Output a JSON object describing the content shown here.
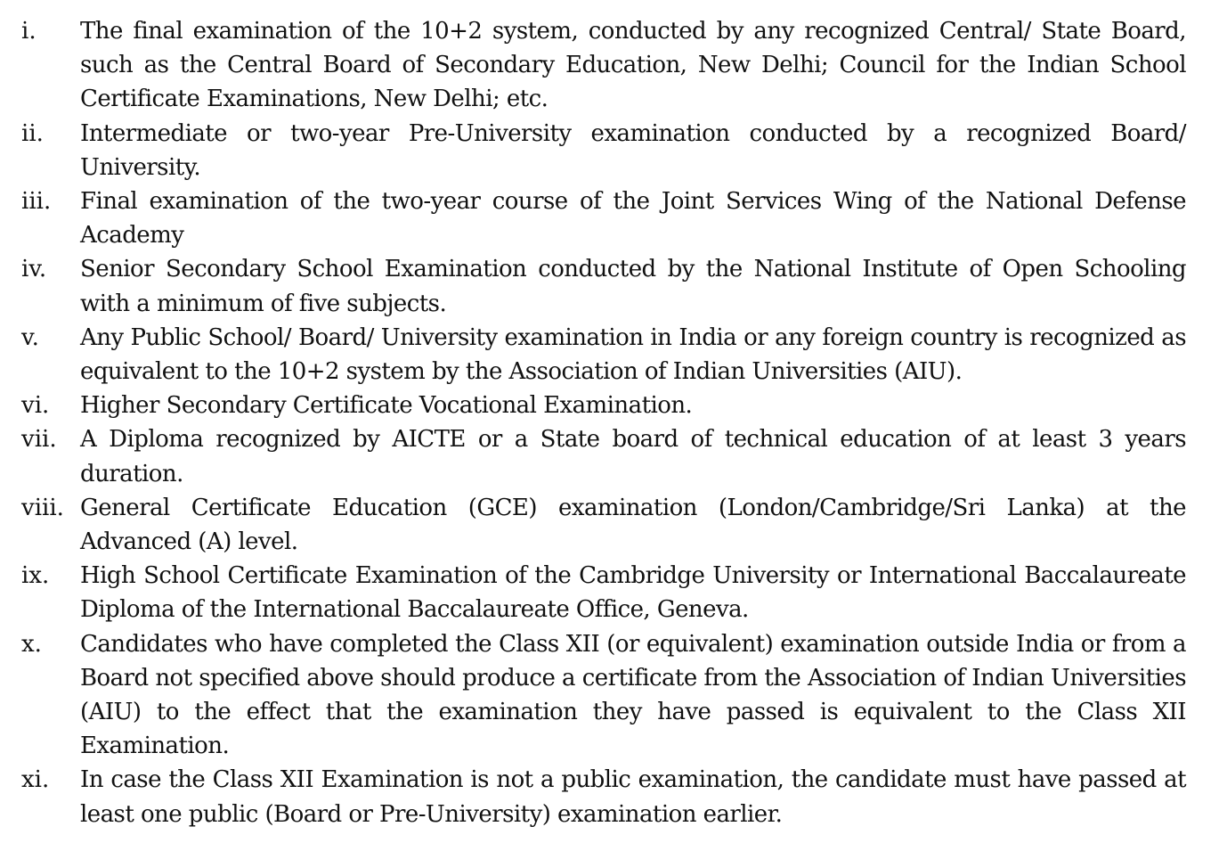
{
  "document": {
    "items": [
      {
        "num": "i.",
        "text": "The final examination of the 10+2 system, conducted by any recognized Central/ State Board, such as the Central Board of Secondary Education, New Delhi; Council for the Indian School Certificate Examinations, New Delhi; etc."
      },
      {
        "num": "ii.",
        "text": "Intermediate or two-year Pre-University examination conducted by a recognized Board/ University."
      },
      {
        "num": "iii.",
        "text": "Final examination of the two-year course of the Joint Services Wing of the National Defense Academy"
      },
      {
        "num": "iv.",
        "text": "Senior Secondary School Examination conducted by the National Institute of Open Schooling with a minimum of five subjects."
      },
      {
        "num": "v.",
        "text": "Any Public School/ Board/ University examination in India or any foreign country is recognized as equivalent to the 10+2 system by the Association of Indian Universities (AIU)."
      },
      {
        "num": "vi.",
        "text": "Higher Secondary Certificate Vocational Examination."
      },
      {
        "num": "vii.",
        "text": "A Diploma recognized by AICTE or a State board of technical education of at least 3 years duration."
      },
      {
        "num": "viii.",
        "text": "General Certificate Education (GCE) examination (London/Cambridge/Sri Lanka) at the Advanced (A) level."
      },
      {
        "num": "ix.",
        "text": "High School Certificate Examination of the Cambridge University or International Baccalaureate Diploma of the International Baccalaureate Office, Geneva."
      },
      {
        "num": "x.",
        "text": "Candidates who have completed the Class XII (or equivalent) examination outside India or from a Board not specified above should produce a certificate from the Association of Indian Universities (AIU) to the effect that the examination they have passed is equivalent to the Class XII Examination."
      },
      {
        "num": "xi.",
        "text": "In case the Class XII Examination is not a public examination, the candidate must have passed at least one public (Board or Pre-University) examination earlier."
      }
    ]
  }
}
